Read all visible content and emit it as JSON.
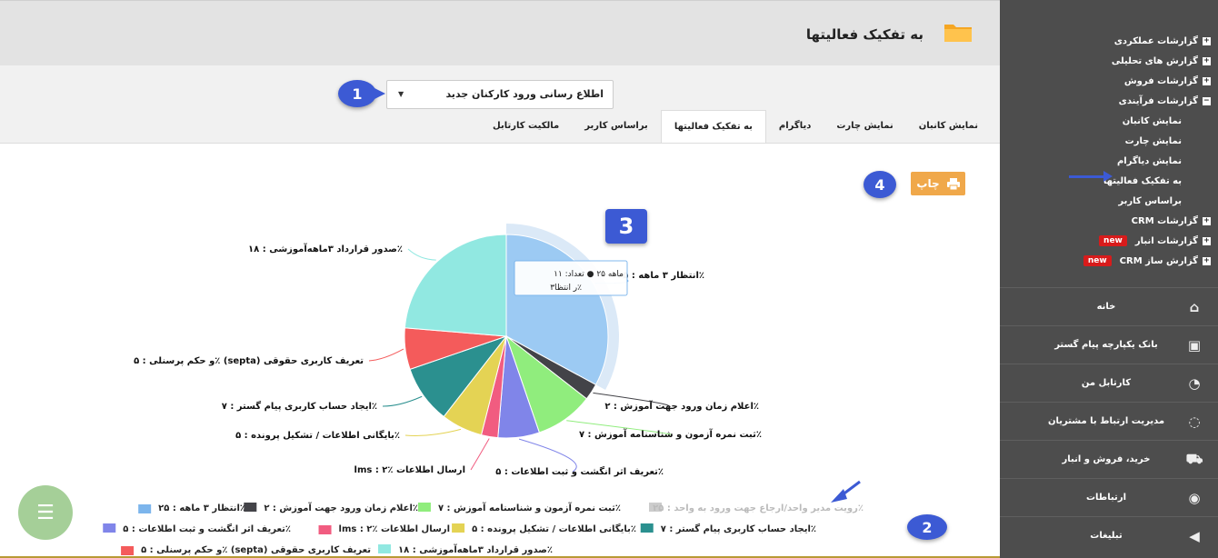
{
  "header": {
    "title": "به تفکیک فعالیتها",
    "icon": "folder-icon"
  },
  "select": {
    "value": "اطلاع رسانی ورود کارکنان جدید"
  },
  "tabs": [
    "نمایش کانبان",
    "نمایش چارت",
    "دیاگرام",
    "به تفکیک فعالیتها",
    "براساس کاربر",
    "مالکیت کارتابل"
  ],
  "active_tab": 3,
  "print_label": "چاپ",
  "markers": {
    "m1": "1",
    "m2": "2",
    "m3": "3",
    "m4": "4"
  },
  "tooltip": {
    "line1": "ماهه ۲۵ ● تعداد: ۱۱",
    "line2": "ر انتظا۳٪"
  },
  "sidebar": {
    "tree": [
      {
        "label": "گزارشات عملکردی",
        "box": "+"
      },
      {
        "label": "گزارش های تحلیلی",
        "box": "+"
      },
      {
        "label": "گزارشات فروش",
        "box": "+"
      },
      {
        "label": "گزارشات فرآیندی",
        "box": "−"
      }
    ],
    "sub": [
      "نمایش کانبان",
      "نمایش چارت",
      "نمایش دیاگرام",
      "به تفکیک فعالیتها",
      "براساس کاربر"
    ],
    "tree2": [
      {
        "label": "گزارشات CRM",
        "box": "+",
        "badge": ""
      },
      {
        "label": "گزارشات انبار",
        "box": "+",
        "badge": "new"
      },
      {
        "label": "گزارش ساز CRM",
        "box": "+",
        "badge": "new"
      }
    ],
    "nav": [
      {
        "label": "خانه",
        "icon": "home-icon"
      },
      {
        "label": "بانک یکپارچه پیام گستر",
        "icon": "bank-icon"
      },
      {
        "label": "کارتابل من",
        "icon": "dashboard-icon"
      },
      {
        "label": "مدیریت ارتباط با مشتریان",
        "icon": "crm-icon"
      },
      {
        "label": "خرید، فروش و انبار",
        "icon": "truck-icon"
      },
      {
        "label": "ارتباطات",
        "icon": "broadcast-icon"
      },
      {
        "label": "تبلیغات",
        "icon": "megaphone-icon"
      }
    ]
  },
  "chart_data": {
    "type": "pie",
    "slices": [
      {
        "label": "انتظار ۳ ماهه : ۲۵٪",
        "legend": "انتظار ۳ ماهه : ۲۵٪",
        "value": 25,
        "color": "#7cb5ec"
      },
      {
        "label": "اعلام زمان ورود جهت آموزش : ۲٪",
        "legend": "اعلام زمان ورود جهت آموزش : ۲٪",
        "value": 2,
        "color": "#434348"
      },
      {
        "label": "ثبت نمره آزمون و شناسنامه آموزش : ۷٪",
        "legend": "ثبت نمره آزمون و شناسنامه آموزش : ۷٪",
        "value": 7,
        "color": "#90ed7d"
      },
      {
        "label": "تعریف اثر انگشت و ثبت اطلاعات : ۵٪",
        "legend": "تعریف اثر انگشت و ثبت اطلاعات : ۵٪",
        "value": 5,
        "color": "#8085e9"
      },
      {
        "label": "lms : ۲٪ ارسال اطلاعات",
        "legend": "lms : ۲٪ ارسال اطلاعات",
        "value": 2,
        "color": "#f15c80"
      },
      {
        "label": "بایگانی اطلاعات / تشکیل پرونده : ۵٪",
        "legend": "بایگانی اطلاعات / تشکیل پرونده : ۵٪",
        "value": 5,
        "color": "#e4d354"
      },
      {
        "label": "ایجاد حساب کاربری پیام گستر : ۷٪",
        "legend": "ایجاد حساب کاربری پیام گستر : ۷٪",
        "value": 7,
        "color": "#2b908f"
      },
      {
        "label": "و حکم پرسنلی : ۵٪ (septa) تعریف کاربری حقوقی",
        "legend": "و حکم پرسنلی : ۵٪ (septa) تعریف کاربری حقوقی",
        "value": 5,
        "color": "#f45b5b"
      },
      {
        "label": "صدور قرارداد ۳ماهه‌آموزشی : ۱۸٪",
        "legend": "صدور قرارداد ۳ماهه‌آموزشی : ۱۸٪",
        "value": 18,
        "color": "#91e8e1"
      }
    ],
    "hidden_legend": "رویت مدیر واحد/ارجاع جهت ورود به واحد : ۲۵٪"
  }
}
